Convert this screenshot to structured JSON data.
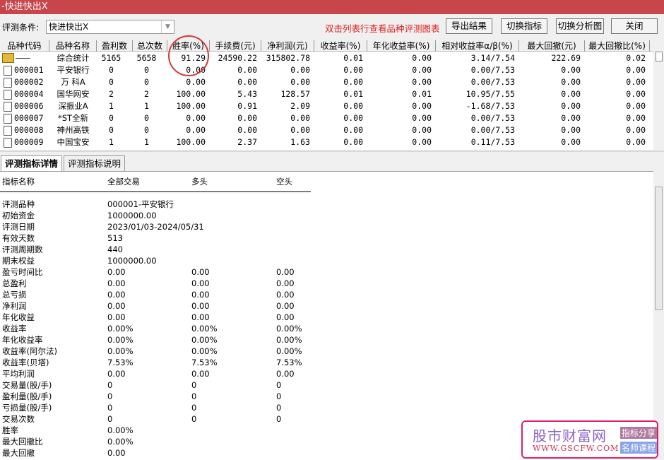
{
  "window": {
    "title": "-快进快出X"
  },
  "toolbar": {
    "condition_label": "评测条件:",
    "condition_value": "快进快出X",
    "hint": "双击列表行查看品种评测图表",
    "export_label": "导出结果",
    "switch_indicator_label": "切换指标",
    "switch_chart_label": "切换分析图",
    "close_label": "关闭"
  },
  "table": {
    "headers": [
      "品种代码",
      "品种名称",
      "盈利数",
      "总次数",
      "胜率(%)",
      "手续费(元)",
      "净利润(元)",
      "收益率(%)",
      "年化收益率(%)",
      "相对收益率α/β(%)",
      "最大回撤(元)",
      "最大回撤比(%)"
    ],
    "rows": [
      [
        "———",
        "综合统计",
        "5165",
        "5658",
        "91.29",
        "24590.22",
        "315802.78",
        "0.01",
        "0.00",
        "3.14/7.54",
        "222.69",
        "0.02"
      ],
      [
        "000001",
        "平安银行",
        "0",
        "0",
        "0.00",
        "0.00",
        "0.00",
        "0.00",
        "0.00",
        "0.00/7.53",
        "0.00",
        "0.00"
      ],
      [
        "000002",
        "万 科A",
        "0",
        "0",
        "0.00",
        "0.00",
        "0.00",
        "0.00",
        "0.00",
        "0.00/7.53",
        "0.00",
        "0.00"
      ],
      [
        "000004",
        "国华网安",
        "2",
        "2",
        "100.00",
        "5.43",
        "128.57",
        "0.01",
        "0.01",
        "10.95/7.55",
        "0.00",
        "0.00"
      ],
      [
        "000006",
        "深振业A",
        "1",
        "1",
        "100.00",
        "0.91",
        "2.09",
        "0.00",
        "0.00",
        "-1.68/7.53",
        "0.00",
        "0.00"
      ],
      [
        "000007",
        "*ST全新",
        "0",
        "0",
        "0.00",
        "0.00",
        "0.00",
        "0.00",
        "0.00",
        "0.00/7.53",
        "0.00",
        "0.00"
      ],
      [
        "000008",
        "神州高铁",
        "0",
        "0",
        "0.00",
        "0.00",
        "0.00",
        "0.00",
        "0.00",
        "0.00/7.53",
        "0.00",
        "0.00"
      ],
      [
        "000009",
        "中国宝安",
        "1",
        "1",
        "100.00",
        "2.37",
        "1.63",
        "0.00",
        "0.00",
        "0.11/7.53",
        "0.00",
        "0.00"
      ]
    ]
  },
  "tabs": [
    {
      "label": "评测指标详情"
    },
    {
      "label": "评测指标说明"
    }
  ],
  "detail": {
    "headers": [
      "指标名称",
      "全部交易",
      "多头",
      "空头"
    ],
    "rows": [
      [
        "评测品种",
        "000001-平安银行",
        "",
        ""
      ],
      [
        "初始资金",
        "1000000.00",
        "",
        ""
      ],
      [
        "评测日期",
        "2023/01/03-2024/05/31",
        "",
        ""
      ],
      [
        "有效天数",
        "513",
        "",
        ""
      ],
      [
        "评测周期数",
        "440",
        "",
        ""
      ],
      [
        "期末权益",
        "1000000.00",
        "",
        ""
      ],
      [
        "盈亏时间比",
        "0.00",
        "0.00",
        "0.00"
      ],
      [
        "总盈利",
        "0.00",
        "0.00",
        "0.00"
      ],
      [
        "总亏损",
        "0.00",
        "0.00",
        "0.00"
      ],
      [
        "净利润",
        "0.00",
        "0.00",
        "0.00"
      ],
      [
        "年化收益",
        "0.00",
        "0.00",
        "0.00"
      ],
      [
        "收益率",
        "0.00%",
        "0.00%",
        "0.00%"
      ],
      [
        "年化收益率",
        "0.00%",
        "0.00%",
        "0.00%"
      ],
      [
        "收益率(阿尔法)",
        "0.00%",
        "0.00%",
        "0.00%"
      ],
      [
        "收益率(贝塔)",
        "7.53%",
        "7.53%",
        "7.53%"
      ],
      [
        "平均利润",
        "0.00",
        "0.00",
        "0.00"
      ],
      [
        "交易量(股/手)",
        "0",
        "0",
        "0"
      ],
      [
        "盈利量(股/手)",
        "0",
        "0",
        "0"
      ],
      [
        "亏损量(股/手)",
        "0",
        "0",
        "0"
      ],
      [
        "交易次数",
        "0",
        "0",
        "0"
      ],
      [
        "胜率",
        "0.00%",
        "",
        ""
      ],
      [
        "最大回撤比",
        "0.00%",
        "",
        ""
      ],
      [
        "最大回撤",
        "0.00",
        "",
        ""
      ]
    ]
  },
  "watermark": {
    "name": "股市财富网",
    "url": "WWW.GSCFW.COM",
    "tag1": "指标分享",
    "tag2": "名师课程"
  }
}
